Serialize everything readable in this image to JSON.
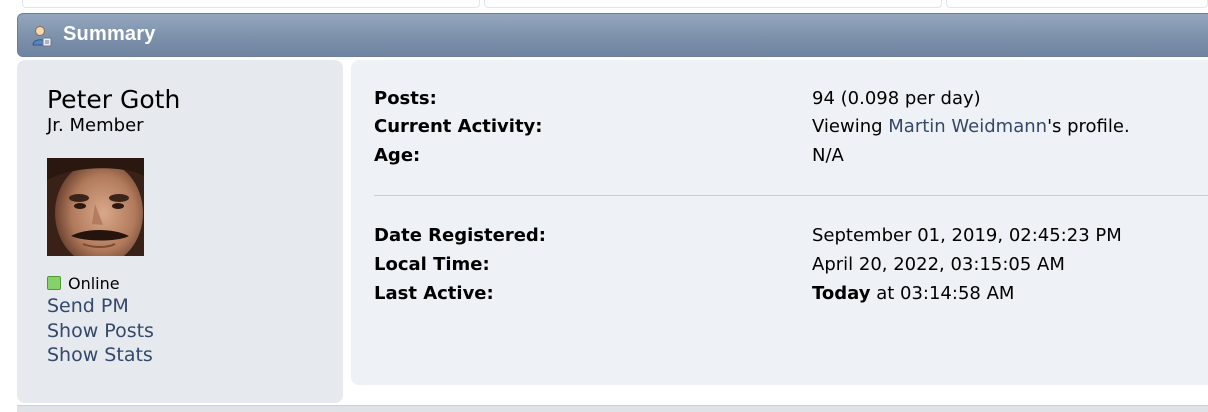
{
  "section": {
    "title": "Summary",
    "icon": "user-summary-icon"
  },
  "profile": {
    "name": "Peter Goth",
    "title": "Jr. Member",
    "status": "Online",
    "links": {
      "send_pm": "Send PM",
      "show_posts": "Show Posts",
      "show_stats": "Show Stats"
    }
  },
  "details": {
    "posts": {
      "label": "Posts:",
      "value": "94 (0.098 per day)"
    },
    "current_activity": {
      "label": "Current Activity:",
      "prefix": "Viewing ",
      "link": "Martin Weidmann",
      "suffix": "'s profile."
    },
    "age": {
      "label": "Age:",
      "value": "N/A"
    },
    "date_registered": {
      "label": "Date Registered:",
      "value": "September 01, 2019, 02:45:23 PM"
    },
    "local_time": {
      "label": "Local Time:",
      "value": "April 20, 2022, 03:15:05 AM"
    },
    "last_active": {
      "label": "Last Active:",
      "bold": "Today",
      "rest": " at 03:14:58 AM"
    }
  },
  "colors": {
    "header_bar": "#7d91ab",
    "panel_left": "#e6e9ee",
    "panel_right": "#eef1f5",
    "link": "#34486a",
    "online": "#86d16a"
  }
}
